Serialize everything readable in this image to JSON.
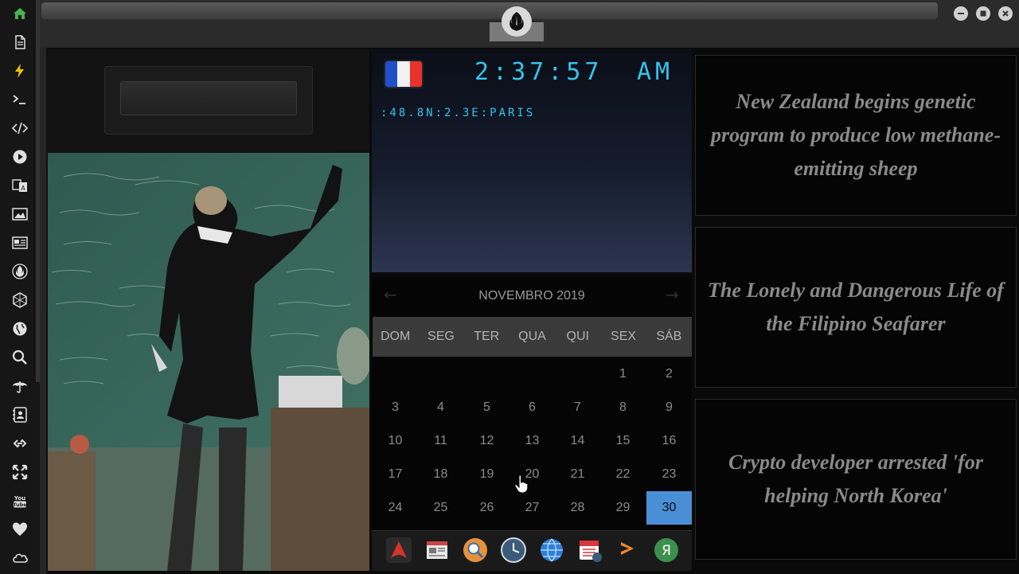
{
  "sidebar": {
    "items": [
      {
        "icon": "home-icon",
        "color": "#4caf50"
      },
      {
        "icon": "document-icon",
        "color": "#e0e0e0"
      },
      {
        "icon": "lightning-icon",
        "color": "#f2c500"
      },
      {
        "icon": "terminal-icon",
        "color": "#e0e0e0"
      },
      {
        "icon": "code-icon",
        "color": "#e0e0e0"
      },
      {
        "icon": "play-icon",
        "color": "#e0e0e0"
      },
      {
        "icon": "translate-icon",
        "color": "#e0e0e0"
      },
      {
        "icon": "image-icon",
        "color": "#e0e0e0"
      },
      {
        "icon": "news-icon",
        "color": "#e0e0e0"
      },
      {
        "icon": "rebel-alliance-icon",
        "color": "#e0e0e0"
      },
      {
        "icon": "hexagon-icon",
        "color": "#e0e0e0"
      },
      {
        "icon": "globe-icon",
        "color": "#e0e0e0"
      },
      {
        "icon": "search-icon",
        "color": "#e0e0e0"
      },
      {
        "icon": "umbrella-icon",
        "color": "#e0e0e0"
      },
      {
        "icon": "contacts-icon",
        "color": "#e0e0e0"
      },
      {
        "icon": "link-icon",
        "color": "#e0e0e0"
      },
      {
        "icon": "expand-icon",
        "color": "#e0e0e0"
      },
      {
        "icon": "youtube-icon",
        "color": "#e0e0e0",
        "text": "You\nTube"
      },
      {
        "icon": "heart-icon",
        "color": "#e0e0e0"
      },
      {
        "icon": "cloud-icon",
        "color": "#e0e0e0"
      }
    ]
  },
  "window": {
    "logo_icon": "rebel-alliance-icon",
    "buttons": [
      "minimize-icon",
      "maximize-icon",
      "close-icon"
    ]
  },
  "search": {
    "value": "",
    "placeholder": ""
  },
  "clock": {
    "flag": "france-flag",
    "flag_colors": [
      "#1f4fc9",
      "#f2f2f2",
      "#e8322b"
    ],
    "time": "2:37:57",
    "ampm": "AM",
    "location": ":48.8N:2.3E:PARIS",
    "accent": "#34c4ec"
  },
  "calendar": {
    "title": "NOVEMBRO 2019",
    "prev": "←",
    "next": "→",
    "weekdays": [
      "DOM",
      "SEG",
      "TER",
      "QUA",
      "QUI",
      "SEX",
      "SÁB"
    ],
    "first_weekday_index": 5,
    "days_in_month": 30,
    "today": 30,
    "today_color": "#4a8fd6"
  },
  "dock": {
    "icons": [
      "arch-linux-icon",
      "news-reader-icon",
      "magnifier-icon",
      "clock-icon",
      "web-browser-icon",
      "calendar-icon",
      "sublime-text-icon",
      "yandex-icon"
    ]
  },
  "news": [
    {
      "headline": "New Zealand begins genetic program to produce low methane-emitting sheep"
    },
    {
      "headline": "The Lonely and Dangerous Life of the Filipino Seafarer"
    },
    {
      "headline": "Crypto developer arrested 'for helping North Korea'"
    }
  ]
}
